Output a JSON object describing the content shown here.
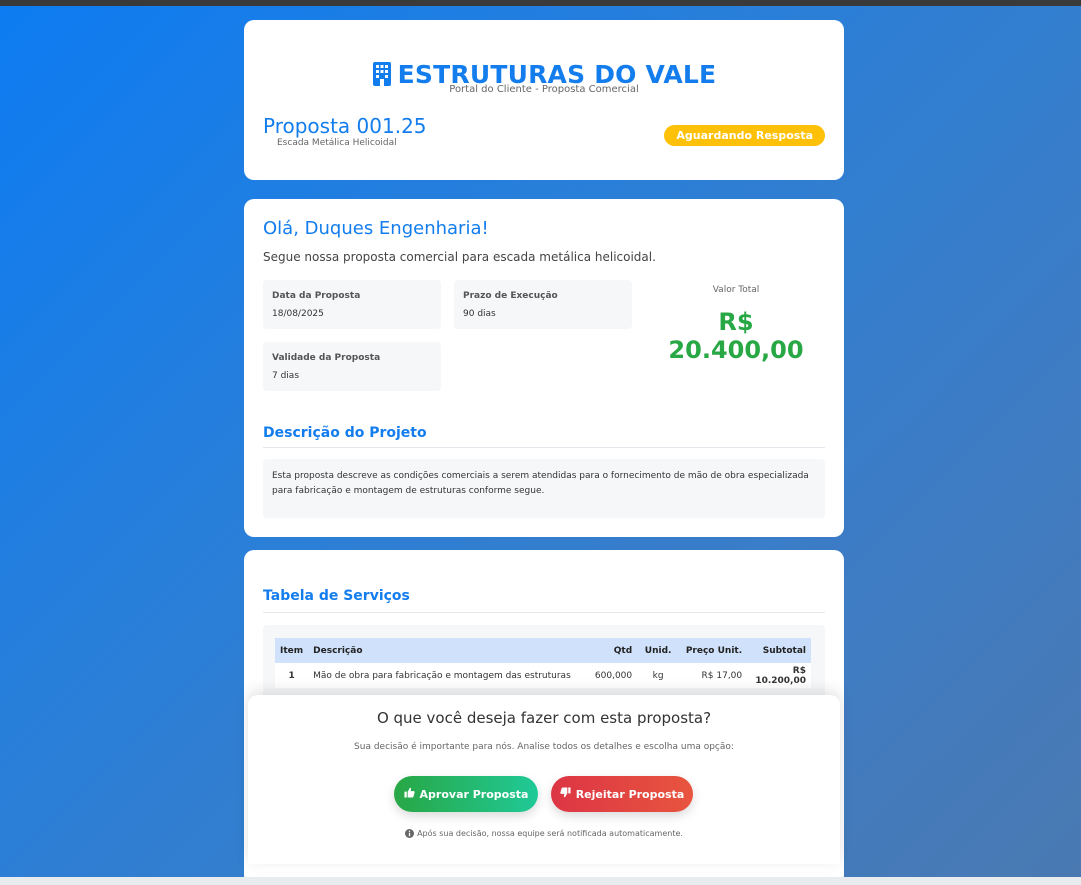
{
  "header": {
    "brand": "ESTRUTURAS DO VALE",
    "brand_icon": "building-icon",
    "subtitle": "Portal do Cliente - Proposta Comercial",
    "proposal_number": "Proposta 001.25",
    "proposal_subject": "Escada Metálica Helicoidal",
    "status": "Aguardando Resposta",
    "status_color": "#ffc107",
    "accent_color": "#137ded"
  },
  "greeting": {
    "title": "Olá, Duques Engenharia!",
    "message": "Segue nossa proposta comercial para escada metálica helicoidal."
  },
  "info": {
    "date_label": "Data da Proposta",
    "date_value": "18/08/2025",
    "deadline_label": "Prazo de Execução",
    "deadline_value": "90 dias",
    "validity_label": "Validade da Proposta",
    "validity_value": "7 dias",
    "total_label": "Valor Total",
    "total_value": "R$ 20.400,00",
    "total_color": "#28a745"
  },
  "description": {
    "title": "Descrição do Projeto",
    "text": "Esta proposta descreve as condições comerciais a serem atendidas para o fornecimento de mão de obra especializada para fabricação e montagem de estruturas conforme segue."
  },
  "services": {
    "title": "Tabela de Serviços",
    "columns": [
      "Item",
      "Descrição",
      "Qtd",
      "Unid.",
      "Preço Unit.",
      "Subtotal"
    ],
    "rows": [
      {
        "item": "1",
        "description": "Mão de obra para fabricação e montagem das estruturas",
        "qty": "600,000",
        "unit": "kg",
        "unit_price": "R$ 17,00",
        "subtotal": "R$ 10.200,00"
      }
    ]
  },
  "decision": {
    "title": "O que você deseja fazer com esta proposta?",
    "subtitle": "Sua decisão é importante para nós. Analise todos os detalhes e escolha uma opção:",
    "approve_label": "Aprovar Proposta",
    "approve_icon": "thumbs-up-icon",
    "reject_label": "Rejeitar Proposta",
    "reject_icon": "thumbs-down-icon",
    "note": "Após sua decisão, nossa equipe será notificada automaticamente.",
    "note_icon": "info-icon"
  }
}
